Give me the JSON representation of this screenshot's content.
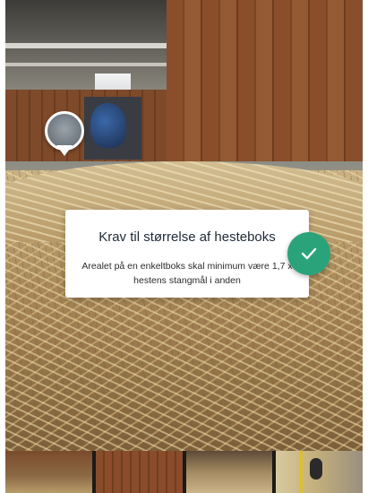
{
  "info_card": {
    "title": "Krav til størrelse af hesteboks",
    "body": "Arealet på en enkeltboks skal minimum være 1,7 x hestens stangmål i anden"
  },
  "colors": {
    "accent": "#2aa37a",
    "card_background": "#ffffff",
    "title_text": "#1f2a36"
  },
  "icons": {
    "confirm": "checkmark-icon",
    "hotspot": "location-pin-icon"
  },
  "thumbnails": [
    {
      "name": "stable-view-1"
    },
    {
      "name": "stable-view-2"
    },
    {
      "name": "stable-view-3"
    },
    {
      "name": "stable-view-4"
    }
  ]
}
